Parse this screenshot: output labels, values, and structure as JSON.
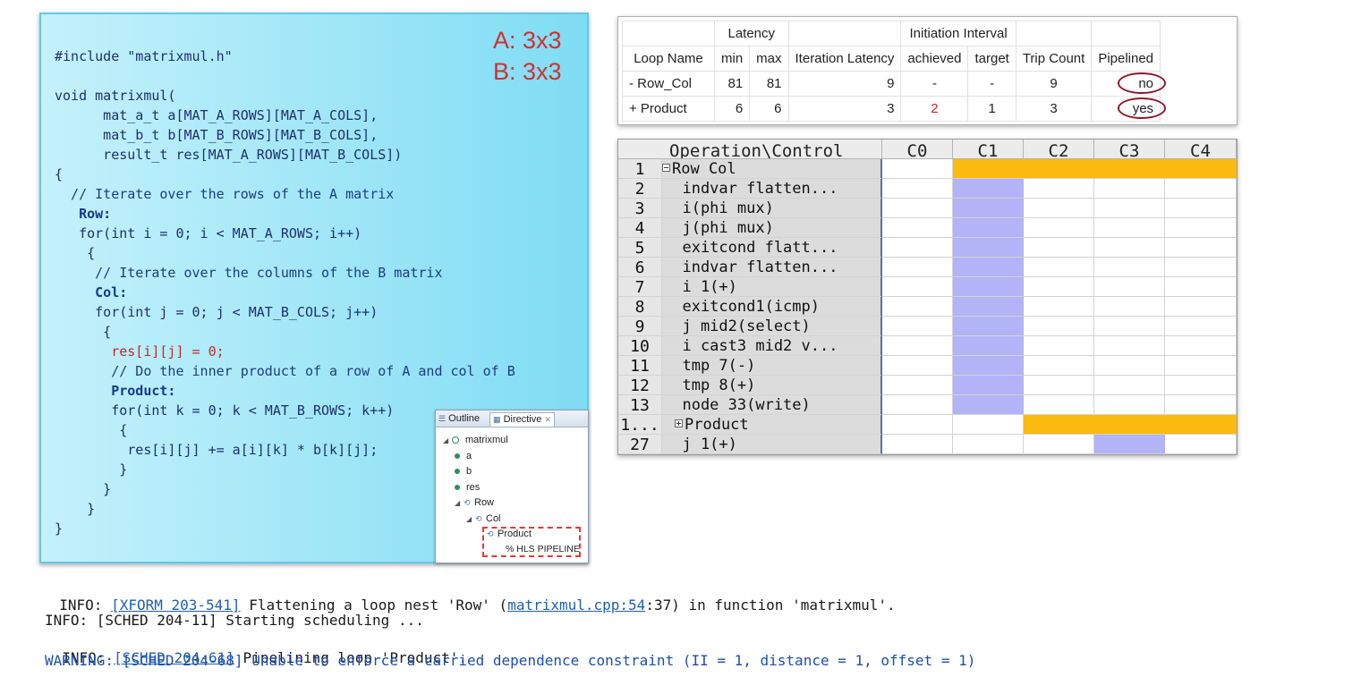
{
  "code": {
    "lines": [
      "#include \"matrixmul.h\"",
      "",
      "void matrixmul(",
      "      mat_a_t a[MAT_A_ROWS][MAT_A_COLS],",
      "      mat_b_t b[MAT_B_ROWS][MAT_B_COLS],",
      "      result_t res[MAT_A_ROWS][MAT_B_COLS])",
      "{",
      "  // Iterate over the rows of the A matrix",
      "   Row:",
      "   for(int i = 0; i < MAT_A_ROWS; i++)",
      "    {",
      "     // Iterate over the columns of the B matrix",
      "     Col:",
      "     for(int j = 0; j < MAT_B_COLS; j++)",
      "      {",
      "       res[i][j] = 0;",
      "       // Do the inner product of a row of A and col of B",
      "       Product:",
      "       for(int k = 0; k < MAT_B_ROWS; k++)",
      "        {",
      "         res[i][j] += a[i][k] * b[k][j];",
      "        }",
      "      }",
      "    }",
      "}"
    ],
    "size_note": [
      "A: 3x3",
      "B: 3x3"
    ]
  },
  "outline": {
    "tabs": [
      "Outline",
      "Directive"
    ],
    "items": [
      {
        "label": "matrixmul",
        "kind": "function",
        "depth": 0
      },
      {
        "label": "a",
        "kind": "var",
        "depth": 1
      },
      {
        "label": "b",
        "kind": "var",
        "depth": 1
      },
      {
        "label": "res",
        "kind": "var",
        "depth": 1
      },
      {
        "label": "Row",
        "kind": "loop",
        "depth": 1
      },
      {
        "label": "Col",
        "kind": "loop",
        "depth": 2
      },
      {
        "label": "Product",
        "kind": "loop",
        "depth": 3
      },
      {
        "label": "% HLS PIPELINE",
        "kind": "directive",
        "depth": 3
      }
    ]
  },
  "loop_table": {
    "group_headers": {
      "latency": "Latency",
      "initiation_interval": "Initiation Interval"
    },
    "columns": [
      "Loop Name",
      "min",
      "max",
      "Iteration Latency",
      "achieved",
      "target",
      "Trip Count",
      "Pipelined"
    ],
    "rows": [
      [
        "- Row_Col",
        "81",
        "81",
        "9",
        "-",
        "-",
        "9",
        "no"
      ],
      [
        "+ Product",
        "6",
        "6",
        "3",
        "2",
        "1",
        "3",
        "yes"
      ]
    ]
  },
  "schedule": {
    "header": [
      "Operation\\Control S...",
      "C0",
      "C1",
      "C2",
      "C3",
      "C4"
    ],
    "rows": [
      {
        "num": "1",
        "op": "Row Col",
        "expander": "minus",
        "fill": [
          null,
          "orange",
          "orange",
          "orange",
          "orange"
        ]
      },
      {
        "num": "2",
        "op": "  indvar flatten...",
        "fill": [
          null,
          "blue",
          null,
          null,
          null
        ]
      },
      {
        "num": "3",
        "op": "  i(phi mux)",
        "fill": [
          null,
          "blue",
          null,
          null,
          null
        ]
      },
      {
        "num": "4",
        "op": "  j(phi mux)",
        "fill": [
          null,
          "blue",
          null,
          null,
          null
        ]
      },
      {
        "num": "5",
        "op": "  exitcond flatt...",
        "fill": [
          null,
          "blue",
          null,
          null,
          null
        ]
      },
      {
        "num": "6",
        "op": "  indvar flatten...",
        "fill": [
          null,
          "blue",
          null,
          null,
          null
        ]
      },
      {
        "num": "7",
        "op": "  i 1(+)",
        "fill": [
          null,
          "blue",
          null,
          null,
          null
        ]
      },
      {
        "num": "8",
        "op": "  exitcond1(icmp)",
        "fill": [
          null,
          "blue",
          null,
          null,
          null
        ]
      },
      {
        "num": "9",
        "op": "  j mid2(select)",
        "fill": [
          null,
          "blue",
          null,
          null,
          null
        ]
      },
      {
        "num": "10",
        "op": "  i cast3 mid2 v...",
        "fill": [
          null,
          "blue",
          null,
          null,
          null
        ]
      },
      {
        "num": "11",
        "op": "  tmp 7(-)",
        "fill": [
          null,
          "blue",
          null,
          null,
          null
        ]
      },
      {
        "num": "12",
        "op": "  tmp 8(+)",
        "fill": [
          null,
          "blue",
          null,
          null,
          null
        ]
      },
      {
        "num": "13",
        "op": "  node 33(write)",
        "fill": [
          null,
          "blue",
          null,
          null,
          null
        ]
      },
      {
        "num": "1...",
        "op": "Product",
        "expander": "plus",
        "fill": [
          null,
          null,
          "orange",
          "orange",
          "orange"
        ]
      },
      {
        "num": "27",
        "op": "  j 1(+)",
        "fill": [
          null,
          null,
          null,
          "blue",
          null
        ]
      }
    ]
  },
  "console": {
    "info1": {
      "prefix": "INFO: ",
      "link": "[XFORM 203-541]",
      "mid": " Flattening a loop nest 'Row' (",
      "link2": "matrixmul.cpp:54",
      "suffix": ":37) in function 'matrixmul'."
    },
    "info2": "INFO: [SCHED 204-11] Starting scheduling ...",
    "info3": {
      "prefix": "INFO: ",
      "link": "[SCHED 204-61]",
      "suffix": " Pipelining loop 'Product'."
    },
    "warning": "WARNING: [SCHED 204-68] Unable to enforce a carried dependence constraint (II = 1, distance = 1, offset = 1)"
  },
  "colors": {
    "orange": "#fbba0f",
    "blue": "#b3b3f7",
    "annotation_red": "#d32f2f"
  }
}
